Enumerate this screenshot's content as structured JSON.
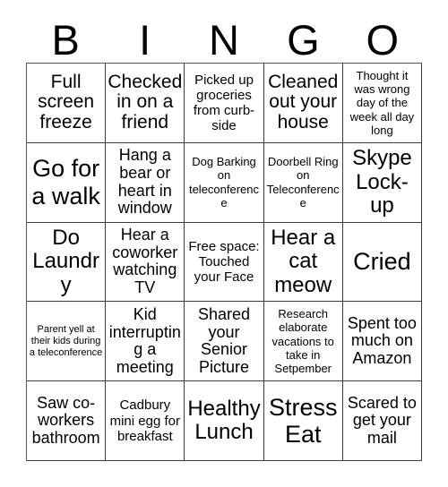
{
  "card": {
    "title": "BINGO",
    "header_letters": [
      "B",
      "I",
      "N",
      "G",
      "O"
    ],
    "colors": {
      "background": "#ffffff",
      "text": "#000000",
      "grid_line": "#3c3c3c"
    },
    "grid": {
      "columns": 5,
      "rows": 5,
      "free_space_position": "row3-col3"
    },
    "cells": [
      [
        {
          "text": "Full screen freeze",
          "size": "lg"
        },
        {
          "text": "Checked in on a friend",
          "size": "lg"
        },
        {
          "text": "Picked up groceries from curb-side",
          "size": "sm"
        },
        {
          "text": "Cleaned out your house",
          "size": "lg"
        },
        {
          "text": "Thought it was wrong day of the week all day long",
          "size": "xs"
        }
      ],
      [
        {
          "text": "Go for a walk",
          "size": "xxl"
        },
        {
          "text": "Hang a bear or heart in window",
          "size": "md"
        },
        {
          "text": "Dog Barking on teleconference",
          "size": "xs"
        },
        {
          "text": "Doorbell Ring on Teleconference",
          "size": "xs"
        },
        {
          "text": "Skype Lock-up",
          "size": "xl"
        }
      ],
      [
        {
          "text": "Do Laundry",
          "size": "xl"
        },
        {
          "text": "Hear a coworker watching TV",
          "size": "md"
        },
        {
          "text": "Free space: Touched your Face",
          "size": "sm"
        },
        {
          "text": "Hear a cat meow",
          "size": "xl"
        },
        {
          "text": "Cried",
          "size": "xxl"
        }
      ],
      [
        {
          "text": "Parent yell at their kids during a teleconference",
          "size": "xxs"
        },
        {
          "text": "Kid interrupting a meeting",
          "size": "md"
        },
        {
          "text": "Shared your Senior Picture",
          "size": "md"
        },
        {
          "text": "Research elaborate vacations to take in Setpember",
          "size": "xs"
        },
        {
          "text": "Spent too much on Amazon",
          "size": "md"
        }
      ],
      [
        {
          "text": "Saw co-workers bathroom",
          "size": "md"
        },
        {
          "text": "Cadbury mini egg for breakfast",
          "size": "sm"
        },
        {
          "text": "Healthy Lunch",
          "size": "xl"
        },
        {
          "text": "Stress Eat",
          "size": "xxl"
        },
        {
          "text": "Scared to get your mail",
          "size": "md"
        }
      ]
    ]
  }
}
